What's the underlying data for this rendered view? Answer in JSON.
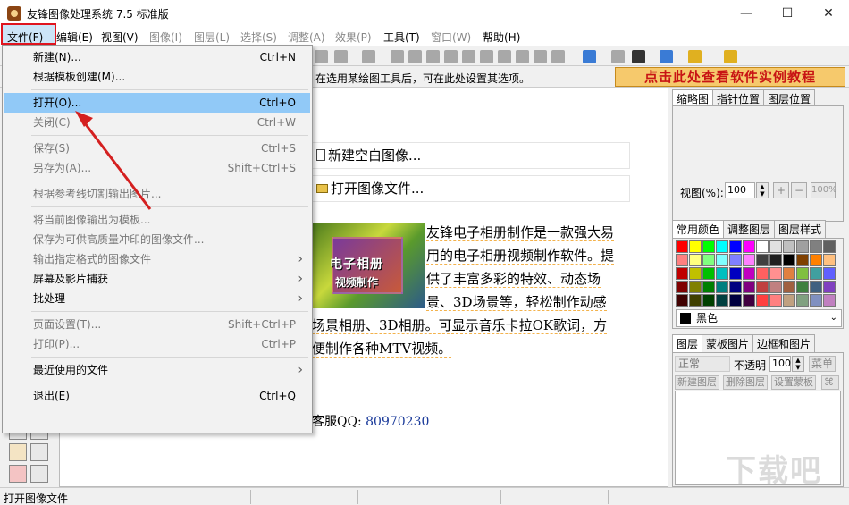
{
  "window": {
    "title": "友锋图像处理系统 7.5 标准版",
    "minimize": "—",
    "maximize": "☐",
    "close": "✕"
  },
  "menubar": {
    "items": [
      {
        "label": "文件(F)",
        "enabled": true
      },
      {
        "label": "编辑(E)",
        "enabled": true
      },
      {
        "label": "视图(V)",
        "enabled": true
      },
      {
        "label": "图像(I)",
        "enabled": false
      },
      {
        "label": "图层(L)",
        "enabled": false
      },
      {
        "label": "选择(S)",
        "enabled": false
      },
      {
        "label": "调整(A)",
        "enabled": false
      },
      {
        "label": "效果(P)",
        "enabled": false
      },
      {
        "label": "工具(T)",
        "enabled": true
      },
      {
        "label": "窗口(W)",
        "enabled": false
      },
      {
        "label": "帮助(H)",
        "enabled": true
      }
    ]
  },
  "optbar": {
    "hint": "在选用某绘图工具后，可在此处设置其选项。",
    "tutorial_banner": "点击此处查看软件实例教程"
  },
  "file_menu": {
    "items": [
      {
        "label": "新建(N)...",
        "shortcut": "Ctrl+N",
        "enabled": true
      },
      {
        "label": "根据模板创建(M)...",
        "shortcut": "",
        "enabled": true
      },
      {
        "separator": true
      },
      {
        "label": "打开(O)...",
        "shortcut": "Ctrl+O",
        "enabled": true,
        "highlight": true
      },
      {
        "label": "关闭(C)",
        "shortcut": "Ctrl+W",
        "enabled": false
      },
      {
        "separator": true
      },
      {
        "label": "保存(S)",
        "shortcut": "Ctrl+S",
        "enabled": false
      },
      {
        "label": "另存为(A)...",
        "shortcut": "Shift+Ctrl+S",
        "enabled": false
      },
      {
        "separator": true
      },
      {
        "label": "根据参考线切割输出图片...",
        "shortcut": "",
        "enabled": false
      },
      {
        "separator": true
      },
      {
        "label": "将当前图像输出为模板...",
        "shortcut": "",
        "enabled": false
      },
      {
        "label": "保存为可供高质量冲印的图像文件...",
        "shortcut": "",
        "enabled": false
      },
      {
        "label": "输出指定格式的图像文件",
        "shortcut": "",
        "enabled": false,
        "submenu": true
      },
      {
        "label": "屏幕及影片捕获",
        "shortcut": "",
        "enabled": true,
        "submenu": true
      },
      {
        "label": "批处理",
        "shortcut": "",
        "enabled": true,
        "submenu": true
      },
      {
        "separator": true
      },
      {
        "label": "页面设置(T)...",
        "shortcut": "Shift+Ctrl+P",
        "enabled": false
      },
      {
        "label": "打印(P)...",
        "shortcut": "Ctrl+P",
        "enabled": false
      },
      {
        "separator": true
      },
      {
        "label": "最近使用的文件",
        "shortcut": "",
        "enabled": true,
        "submenu": true
      },
      {
        "separator": true
      },
      {
        "label": "退出(E)",
        "shortcut": "Ctrl+Q",
        "enabled": true
      }
    ]
  },
  "start_page": {
    "new_blank": "新建空白图像...",
    "open_image": "打开图像文件...",
    "promo_line1": "电子相册",
    "promo_line2": "视频制作",
    "description_lines": [
      "友锋电子相册制作是一款强大易",
      "用的电子相册视频制作软件。提",
      "供了丰富多彩的特效、动态场",
      "景、3D场景等，轻松制作动感",
      "场景相册、3D相册。可显示音乐卡拉OK歌词，方",
      "便制作各种MTV视频。"
    ],
    "qq_label": "客服QQ: ",
    "qq_number": "80970230"
  },
  "right_panel": {
    "nav_tabs": [
      "缩略图",
      "指针位置",
      "图层位置"
    ],
    "zoom_label": "视图(%):",
    "zoom_value": "100",
    "zoom_in": "+",
    "zoom_out": "−",
    "zoom_100": "100%",
    "color_tabs": [
      "常用颜色",
      "调整图层",
      "图层样式"
    ],
    "selected_color": "黑色",
    "layer_tabs": [
      "图层",
      "蒙板图片",
      "边框和图片"
    ],
    "blend_mode": "正常",
    "opacity_label": "不透明",
    "opacity_value": "100",
    "menu_button": "菜单",
    "layer_buttons": [
      "新建图层",
      "删除图层",
      "设置蒙板"
    ]
  },
  "palette": [
    "#ff0000",
    "#ffff00",
    "#00ff00",
    "#00ffff",
    "#0000ff",
    "#ff00ff",
    "#ffffff",
    "#e0e0e0",
    "#c0c0c0",
    "#a0a0a0",
    "#808080",
    "#606060",
    "#ff8080",
    "#ffff80",
    "#80ff80",
    "#80ffff",
    "#8080ff",
    "#ff80ff",
    "#404040",
    "#202020",
    "#000000",
    "#804000",
    "#ff8000",
    "#ffc080",
    "#c00000",
    "#c0c000",
    "#00c000",
    "#00c0c0",
    "#0000c0",
    "#c000c0",
    "#ff6060",
    "#ff9090",
    "#e08040",
    "#80c040",
    "#40a0a0",
    "#6060ff",
    "#800000",
    "#808000",
    "#008000",
    "#008080",
    "#000080",
    "#800080",
    "#c04040",
    "#c08080",
    "#a06040",
    "#408040",
    "#406080",
    "#8040c0",
    "#400000",
    "#404000",
    "#004000",
    "#004040",
    "#000040",
    "#400040",
    "#ff4040",
    "#ff8080",
    "#c0a080",
    "#80a080",
    "#8090c0",
    "#c080c0"
  ],
  "statusbar": {
    "text": "打开图像文件"
  },
  "watermark": "下载吧"
}
